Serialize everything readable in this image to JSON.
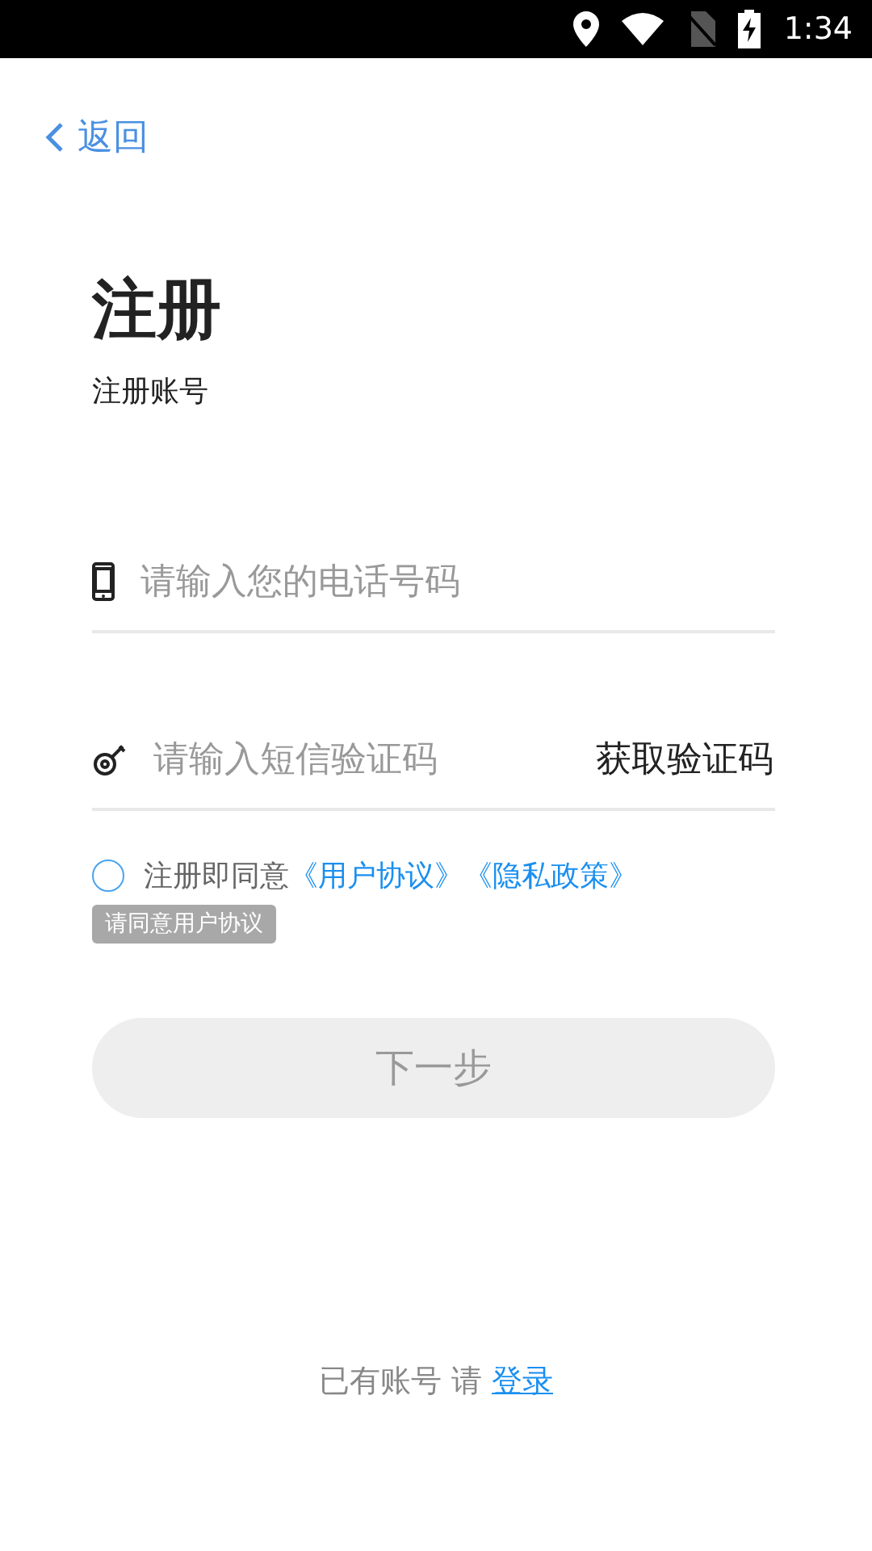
{
  "status_bar": {
    "time": "1:34"
  },
  "back": {
    "label": "返回"
  },
  "title": "注册",
  "subtitle": "注册账号",
  "phone_field": {
    "placeholder": "请输入您的电话号码"
  },
  "code_field": {
    "placeholder": "请输入短信验证码",
    "action": "获取验证码"
  },
  "agreement": {
    "checked": false,
    "text": "注册即同意",
    "links": [
      "《用户协议》",
      "《隐私政策》"
    ],
    "tooltip": "请同意用户协议"
  },
  "next_button": {
    "label": "下一步",
    "disabled": true
  },
  "footer": {
    "text": "已有账号 请",
    "link": "登录"
  }
}
